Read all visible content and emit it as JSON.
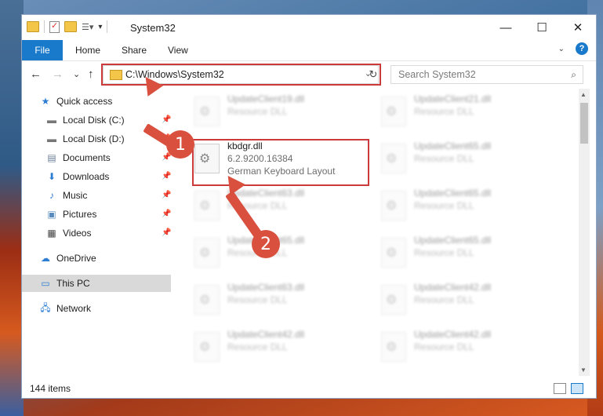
{
  "window": {
    "title": "System32"
  },
  "controls": {
    "minimize": "—",
    "maximize": "☐",
    "close": "✕"
  },
  "ribbon": {
    "file": "File",
    "tabs": [
      "Home",
      "Share",
      "View"
    ],
    "help": "?"
  },
  "navigation": {
    "back": "←",
    "forward": "→",
    "recent": "⌄",
    "up": "↑",
    "address": "C:\\Windows\\System32",
    "search_placeholder": "Search System32"
  },
  "sidebar": {
    "quick_access": "Quick access",
    "items": [
      {
        "label": "Local Disk (C:)",
        "icon": "drive-icon"
      },
      {
        "label": "Local Disk (D:)",
        "icon": "drive-icon"
      },
      {
        "label": "Documents",
        "icon": "documents-icon"
      },
      {
        "label": "Downloads",
        "icon": "downloads-icon"
      },
      {
        "label": "Music",
        "icon": "music-icon"
      },
      {
        "label": "Pictures",
        "icon": "pictures-icon"
      },
      {
        "label": "Videos",
        "icon": "videos-icon"
      }
    ],
    "onedrive": "OneDrive",
    "this_pc": "This PC",
    "network": "Network"
  },
  "files": {
    "selected": {
      "name": "kbdgr.dll",
      "version": "6.2.9200.16384",
      "description": "German Keyboard Layout"
    },
    "left_column": [
      {
        "name": "UpdateClient19.dll",
        "type": "Resource DLL"
      },
      {
        "name": "UpdateClient63.dll",
        "type": "Resource DLL"
      },
      {
        "name": "UpdateClient65.dll",
        "type": "Resource DLL"
      },
      {
        "name": "UpdateClient63.dll",
        "type": "Resource DLL"
      },
      {
        "name": "UpdateClient42.dll",
        "type": "Resource DLL"
      }
    ],
    "right_column": [
      {
        "name": "UpdateClient21.dll",
        "type": "Resource DLL"
      },
      {
        "name": "UpdateClient65.dll",
        "type": "Resource DLL"
      },
      {
        "name": "UpdateClient65.dll",
        "type": "Resource DLL"
      },
      {
        "name": "UpdateClient65.dll",
        "type": "Resource DLL"
      },
      {
        "name": "UpdateClient42.dll",
        "type": "Resource DLL"
      },
      {
        "name": "UpdateClient42.dll",
        "type": "Resource DLL"
      }
    ]
  },
  "status": {
    "count": "144 items"
  },
  "annotations": {
    "step1": "1",
    "step2": "2",
    "color": "#d9503f"
  }
}
